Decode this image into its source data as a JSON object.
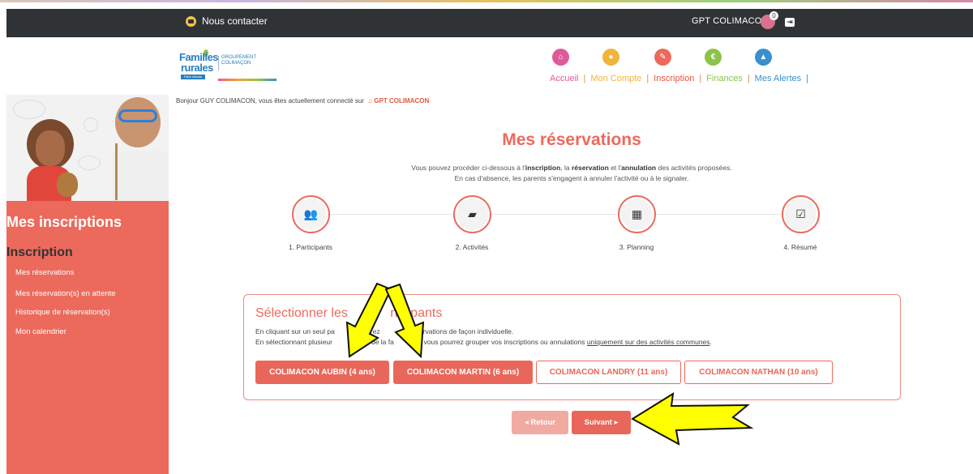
{
  "topbar": {
    "contact_label": "Nous contacter",
    "account_name": "GPT COLIMACON",
    "cart_count": "0",
    "logout_glyph": "⇥"
  },
  "logo": {
    "line1": "Familles",
    "line2": "rurales",
    "group1": "GROUPEMENT",
    "group2": "COLIMAÇON",
    "tag": "Faire réseau"
  },
  "nav": {
    "items": [
      {
        "label": "Accueil",
        "icon": "home-icon",
        "color": "#e05a9a",
        "glyph": "⌂"
      },
      {
        "label": "Mon Compte",
        "icon": "user-icon",
        "color": "#f0b43a",
        "glyph": "●"
      },
      {
        "label": "Inscription",
        "icon": "pencil-icon",
        "color": "#ec6a5c",
        "glyph": "✎"
      },
      {
        "label": "Finances",
        "icon": "euro-icon",
        "color": "#8cc34a",
        "glyph": "€"
      },
      {
        "label": "Mes Alertes",
        "icon": "alert-icon",
        "color": "#3a8fd0",
        "glyph": "▲"
      }
    ]
  },
  "sidebar": {
    "heading": "Mes inscriptions",
    "subheading": "Inscription",
    "links": [
      "Mes réservations",
      "Mes réservation(s) en attente",
      "Historique de réservation(s)",
      "Mon calendrier"
    ]
  },
  "greeting": {
    "prefix": "Bonjour GUY COLIMACON, vous êtes actuellement connecté sur",
    "house": "⌂",
    "account": "GPT COLIMACON"
  },
  "main": {
    "title": "Mes réservations",
    "intro_line1_a": "Vous pouvez procéder ci-dessous à l'",
    "intro_line1_b": "inscription",
    "intro_line1_c": ", la ",
    "intro_line1_d": "réservation",
    "intro_line1_e": " et l'",
    "intro_line1_f": "annulation",
    "intro_line1_g": " des activités proposées.",
    "intro_line2": "En cas d'absence, les parents s'engagent à annuler l'activité ou à le signaler."
  },
  "steps": [
    {
      "label": "1. Participants",
      "icon": "users-icon",
      "glyph": "👥"
    },
    {
      "label": "2. Activités",
      "icon": "book-icon",
      "glyph": "▰"
    },
    {
      "label": "3. Planning",
      "icon": "calendar-icon",
      "glyph": "▦"
    },
    {
      "label": "4. Résumé",
      "icon": "checkbox-icon",
      "glyph": "☑"
    }
  ],
  "participants": {
    "title_a": "Sélectionner les ",
    "title_b": "rticipants",
    "line1_a": "En cliquant sur un seul pa",
    "line1_b": "ant, gérez ",
    "line1_c": "ervations de façon individuelle.",
    "line2_a": "En sélectionnant plusieur",
    "line2_b": "mbres de la fa",
    "line2_c": ", vous pourrez grouper vos inscriptions ou annulations ",
    "line2_d": "uniquement sur des activités communes",
    "line2_e": ".",
    "buttons": [
      {
        "label": "COLIMACON AUBIN (4 ans)",
        "selected": true
      },
      {
        "label": "COLIMACON MARTIN (6 ans)",
        "selected": true
      },
      {
        "label": "COLIMACON LANDRY (11 ans)",
        "selected": false
      },
      {
        "label": "COLIMACON NATHAN (10 ans)",
        "selected": false
      }
    ]
  },
  "actions": {
    "back": "◂ Retour",
    "next": "Suivant ▸"
  },
  "colors": {
    "accent": "#ec6a5c",
    "topbar": "#2f3336",
    "annotation_arrow": "#ffff00"
  }
}
